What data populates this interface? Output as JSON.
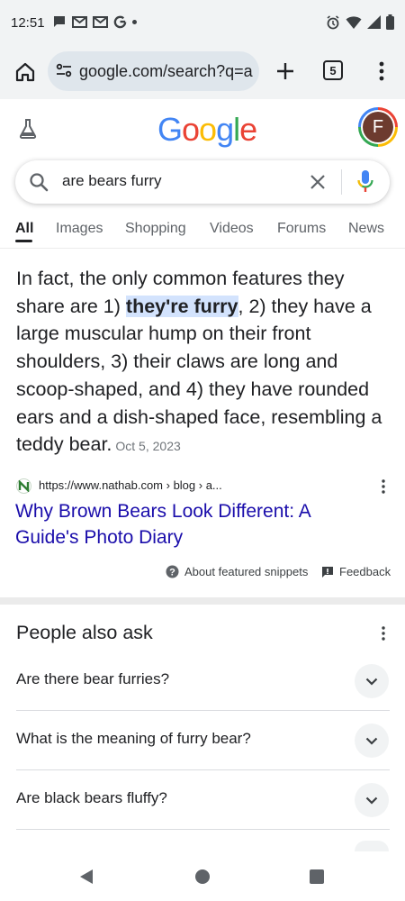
{
  "status_bar": {
    "time": "12:51",
    "left_icons": [
      "chat-icon",
      "gmail-icon",
      "gmail-icon",
      "google-icon",
      "dot-icon"
    ],
    "right_icons": [
      "alarm-icon",
      "wifi-icon",
      "signal-icon",
      "battery-icon"
    ]
  },
  "browser": {
    "url": "google.com/search?q=a",
    "tab_count": "5"
  },
  "google": {
    "logo_letters": [
      "G",
      "o",
      "o",
      "g",
      "l",
      "e"
    ],
    "logo_colors": [
      "#4285f4",
      "#ea4335",
      "#fbbc05",
      "#4285f4",
      "#34a853",
      "#ea4335"
    ],
    "avatar_initial": "F",
    "avatar_color": "#6d3b2f"
  },
  "search": {
    "query": "are bears furry"
  },
  "tabs": [
    {
      "label": "All",
      "active": true
    },
    {
      "label": "Images",
      "active": false
    },
    {
      "label": "Shopping",
      "active": false
    },
    {
      "label": "Videos",
      "active": false
    },
    {
      "label": "Forums",
      "active": false
    },
    {
      "label": "News",
      "active": false
    }
  ],
  "featured_snippet": {
    "text_before": "In fact, the only common features they share are 1) ",
    "highlight": "they're furry",
    "text_after": ", 2) they have a large muscular hump on their front shoulders, 3) their claws are long and scoop-shaped, and 4) they have rounded ears and a dish-shaped face, resembling a teddy bear.",
    "date": "Oct 5, 2023",
    "source_url": "https://www.nathab.com › blog › a...",
    "title": "Why Brown Bears Look Different: A Guide's Photo Diary",
    "about_label": "About featured snippets",
    "feedback_label": "Feedback"
  },
  "people_also_ask": {
    "title": "People also ask",
    "questions": [
      "Are there bear furries?",
      "What is the meaning of furry bear?",
      "Are black bears fluffy?"
    ]
  },
  "colors": {
    "link": "#1a0dab",
    "highlight": "#d3e3fd",
    "chrome_bg": "#f1f3f4",
    "url_pill": "#dfe6ec"
  }
}
